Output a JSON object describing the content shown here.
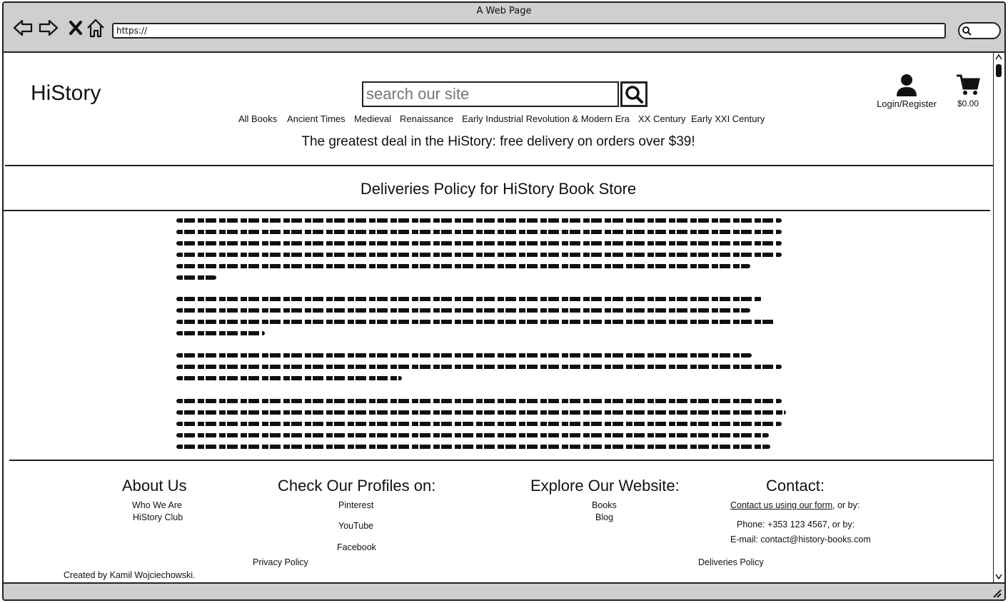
{
  "browser": {
    "window_title": "A Web Page",
    "url": "https://"
  },
  "header": {
    "logo": "HiStory",
    "search_placeholder": "search our site",
    "nav": [
      "All Books",
      "Ancient Times",
      "Medieval",
      "Renaissance",
      "Early Industrial Revolution & Modern Era",
      "XX Century",
      "Early XXI Century"
    ],
    "account_label": "Login/Register",
    "cart_total": "$0.00",
    "promo": "The greatest deal in the HiStory: free delivery on orders over $39!"
  },
  "main": {
    "title": "Deliveries Policy for HiStory Book Store"
  },
  "footer": {
    "about": {
      "heading": "About Us",
      "links": [
        "Who We Are",
        "HiStory Club"
      ]
    },
    "profiles": {
      "heading": "Check Our Profiles on:",
      "links": [
        "Pinterest",
        "YouTube",
        "Facebook"
      ]
    },
    "explore": {
      "heading": "Explore Our Website:",
      "links": [
        "Books",
        "Blog"
      ]
    },
    "contact": {
      "heading": "Contact:",
      "form_link": "Contact us using our form",
      "form_suffix": ", or by:",
      "phone": "Phone: +353 123 4567, or by:",
      "email": "E-mail: contact@history-books.com"
    },
    "privacy": "Privacy Policy",
    "deliveries": "Deliveries Policy",
    "credit": "Created by Kamil Wojciechowski."
  }
}
